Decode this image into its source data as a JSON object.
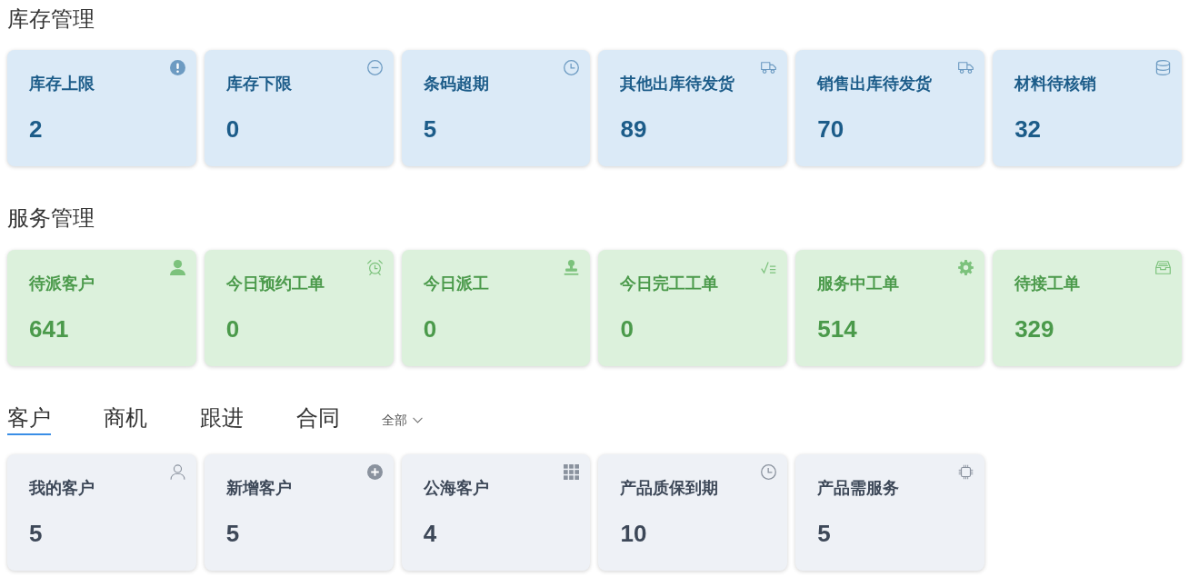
{
  "sections": [
    {
      "kind": "info",
      "title": "库存管理",
      "cards": [
        {
          "label": "库存上限",
          "value": "2",
          "kind": "exclamation"
        },
        {
          "label": "库存下限",
          "value": "0",
          "kind": "minus"
        },
        {
          "label": "条码超期",
          "value": "5",
          "kind": "clock"
        },
        {
          "label": "其他出库待发货",
          "value": "89",
          "kind": "truck"
        },
        {
          "label": "销售出库待发货",
          "value": "70",
          "kind": "truck"
        },
        {
          "label": "材料待核销",
          "value": "32",
          "kind": "database"
        }
      ]
    },
    {
      "kind": "success",
      "title": "服务管理",
      "cards": [
        {
          "label": "待派客户",
          "value": "641",
          "kind": "user"
        },
        {
          "label": "今日预约工单",
          "value": "0",
          "kind": "alarm"
        },
        {
          "label": "今日派工",
          "value": "0",
          "kind": "stamp"
        },
        {
          "label": "今日完工工单",
          "value": "0",
          "kind": "checklist"
        },
        {
          "label": "服务中工单",
          "value": "514",
          "kind": "gear"
        },
        {
          "label": "待接工单",
          "value": "329",
          "kind": "inbox"
        }
      ]
    },
    {
      "kind": "neutral",
      "tabs": [
        {
          "label": "客户",
          "selected": true
        },
        {
          "label": "商机",
          "selected": false
        },
        {
          "label": "跟进",
          "selected": false
        },
        {
          "label": "合同",
          "selected": false
        }
      ],
      "filter": {
        "value": "全部"
      },
      "cards": [
        {
          "label": "我的客户",
          "value": "5",
          "kind": "profile"
        },
        {
          "label": "新增客户",
          "value": "5",
          "kind": "plus"
        },
        {
          "label": "公海客户",
          "value": "4",
          "kind": "grid"
        },
        {
          "label": "产品质保到期",
          "value": "10",
          "kind": "clock"
        },
        {
          "label": "产品需服务",
          "value": "5",
          "kind": "chip"
        }
      ]
    }
  ]
}
